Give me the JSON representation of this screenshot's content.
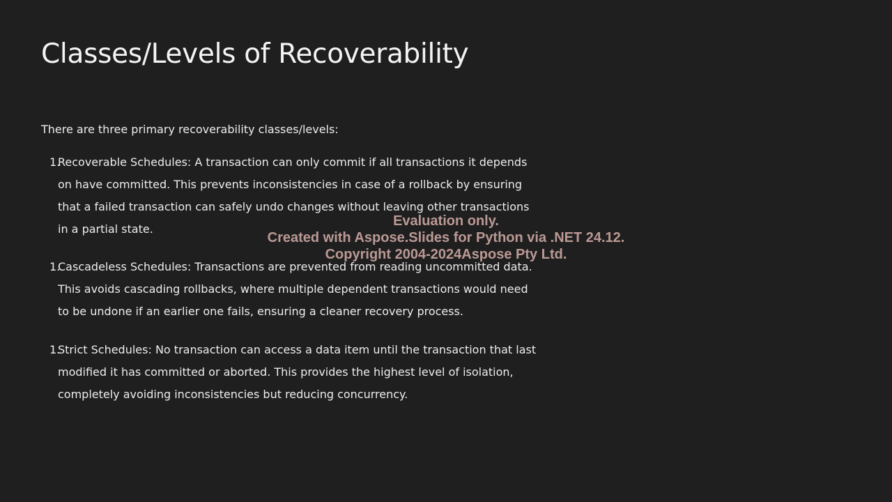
{
  "slide": {
    "title": "Classes/Levels of Recoverability",
    "intro": "There are three primary recoverability classes/levels:",
    "items": [
      {
        "number": "1.",
        "lines": [
          "Recoverable Schedules: A transaction can only commit if all transactions it depends",
          "on have committed. This prevents inconsistencies in case of a rollback by ensuring",
          "that a failed transaction can safely undo changes without leaving other transactions",
          "in a partial state."
        ]
      },
      {
        "number": "1.",
        "lines": [
          "Cascadeless Schedules: Transactions are prevented from reading uncommitted data.",
          "This avoids cascading rollbacks, where multiple dependent transactions would need",
          "to be undone if an earlier one fails, ensuring a cleaner recovery process."
        ]
      },
      {
        "number": "1.",
        "lines": [
          "Strict Schedules: No transaction can access a data item until the transaction that last",
          "modified it has committed or aborted. This provides the highest level of isolation,",
          "completely avoiding inconsistencies but reducing concurrency."
        ]
      }
    ]
  },
  "watermark": {
    "line1": "Evaluation only.",
    "line2": "Created with Aspose.Slides for Python via .NET 24.12.",
    "line3": "Copyright 2004-2024Aspose Pty Ltd."
  },
  "colors": {
    "background": "#1f1f1f",
    "text": "#ededed",
    "watermark": "#deb4b0"
  }
}
